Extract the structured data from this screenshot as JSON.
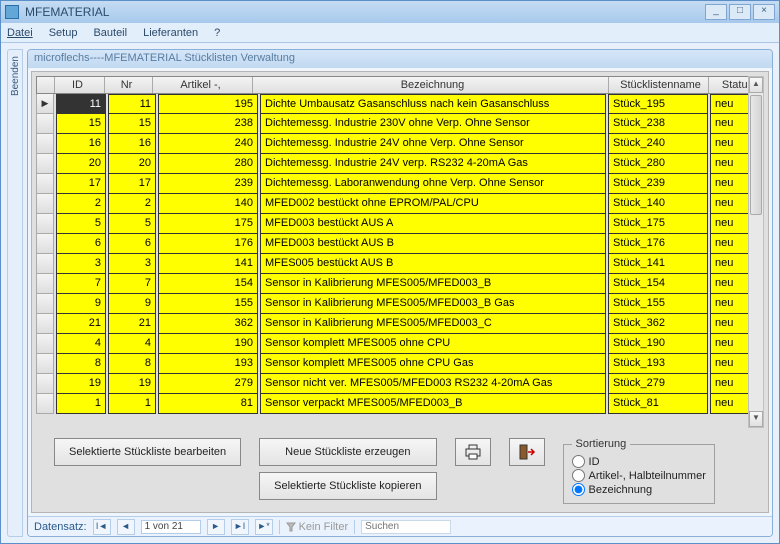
{
  "window": {
    "title": "MFEMATERIAL",
    "minimize": "_",
    "maximize": "□",
    "close": "×"
  },
  "menu": {
    "datei": "Datei",
    "setup": "Setup",
    "bauteil": "Bauteil",
    "lieferanten": "Lieferanten",
    "help": "?"
  },
  "sidebar": {
    "beenden": "Beenden"
  },
  "inner": {
    "title": "microflechs----MFEMATERIAL Stücklisten Verwaltung"
  },
  "columns": {
    "id": "ID",
    "nr": "Nr",
    "artikel": "Artikel -, Halbteilnummer",
    "bezeichnung": "Bezeichnung",
    "stuecklistenname": "Stücklistenname",
    "status": "Status"
  },
  "rows": [
    {
      "id": "11",
      "nr": "11",
      "art": "195",
      "bez": "Dichte Umbausatz Gasanschluss nach kein Gasanschluss",
      "name": "Stück_195",
      "status": "neu",
      "sel": true
    },
    {
      "id": "15",
      "nr": "15",
      "art": "238",
      "bez": "Dichtemessg. Industrie 230V ohne Verp. Ohne Sensor",
      "name": "Stück_238",
      "status": "neu"
    },
    {
      "id": "16",
      "nr": "16",
      "art": "240",
      "bez": "Dichtemessg. Industrie 24V ohne Verp. Ohne Sensor",
      "name": "Stück_240",
      "status": "neu"
    },
    {
      "id": "20",
      "nr": "20",
      "art": "280",
      "bez": "Dichtemessg. Industrie 24V verp. RS232 4-20mA Gas",
      "name": "Stück_280",
      "status": "neu"
    },
    {
      "id": "17",
      "nr": "17",
      "art": "239",
      "bez": "Dichtemessg. Laboranwendung ohne Verp. Ohne Sensor",
      "name": "Stück_239",
      "status": "neu"
    },
    {
      "id": "2",
      "nr": "2",
      "art": "140",
      "bez": "MFED002 bestückt ohne EPROM/PAL/CPU",
      "name": "Stück_140",
      "status": "neu"
    },
    {
      "id": "5",
      "nr": "5",
      "art": "175",
      "bez": "MFED003 bestückt AUS A",
      "name": "Stück_175",
      "status": "neu"
    },
    {
      "id": "6",
      "nr": "6",
      "art": "176",
      "bez": "MFED003 bestückt AUS B",
      "name": "Stück_176",
      "status": "neu"
    },
    {
      "id": "3",
      "nr": "3",
      "art": "141",
      "bez": "MFES005 bestückt AUS B",
      "name": "Stück_141",
      "status": "neu"
    },
    {
      "id": "7",
      "nr": "7",
      "art": "154",
      "bez": "Sensor in Kalibrierung MFES005/MFED003_B",
      "name": "Stück_154",
      "status": "neu"
    },
    {
      "id": "9",
      "nr": "9",
      "art": "155",
      "bez": "Sensor in Kalibrierung MFES005/MFED003_B Gas",
      "name": "Stück_155",
      "status": "neu"
    },
    {
      "id": "21",
      "nr": "21",
      "art": "362",
      "bez": "Sensor in Kalibrierung MFES005/MFED003_C",
      "name": "Stück_362",
      "status": "neu"
    },
    {
      "id": "4",
      "nr": "4",
      "art": "190",
      "bez": "Sensor komplett MFES005 ohne CPU",
      "name": "Stück_190",
      "status": "neu"
    },
    {
      "id": "8",
      "nr": "8",
      "art": "193",
      "bez": "Sensor komplett MFES005 ohne CPU Gas",
      "name": "Stück_193",
      "status": "neu"
    },
    {
      "id": "19",
      "nr": "19",
      "art": "279",
      "bez": "Sensor nicht ver. MFES005/MFED003 RS232 4-20mA Gas",
      "name": "Stück_279",
      "status": "neu"
    },
    {
      "id": "1",
      "nr": "1",
      "art": "81",
      "bez": "Sensor verpackt MFES005/MFED003_B",
      "name": "Stück_81",
      "status": "neu"
    }
  ],
  "buttons": {
    "edit": "Selektierte Stückliste bearbeiten",
    "new": "Neue Stückliste erzeugen",
    "copy": "Selektierte Stückliste kopieren"
  },
  "sort": {
    "legend": "Sortierung",
    "id": "ID",
    "artikel": "Artikel-, Halbteilnummer",
    "bez": "Bezeichnung"
  },
  "nav": {
    "label": "Datensatz:",
    "pos": "1 von 21",
    "filter": "Kein Filter",
    "search": "Suchen"
  }
}
